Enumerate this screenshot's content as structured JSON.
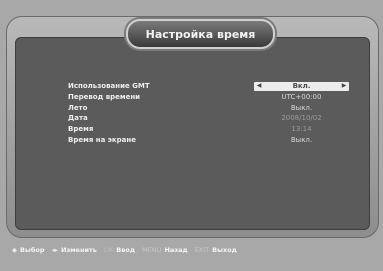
{
  "window": {
    "title": "Настройка время"
  },
  "settings": [
    {
      "label": "Использование GMT",
      "value": "Вкл.",
      "selected": true
    },
    {
      "label": "Перевод времени",
      "value": "UTC+00:00",
      "selected": false
    },
    {
      "label": "Лето",
      "value": "Выкл.",
      "selected": false
    },
    {
      "label": "Дата",
      "value": "2008/10/02",
      "selected": false
    },
    {
      "label": "Время",
      "value": "13:14",
      "selected": false
    },
    {
      "label": "Время на экране",
      "value": "Выкл.",
      "selected": false
    }
  ],
  "footer": {
    "hints": [
      {
        "key": "◆",
        "label": "Выбор"
      },
      {
        "key": "◂▸",
        "label": "Изменить"
      },
      {
        "key": "OK",
        "label": "Ввод"
      },
      {
        "key": "MENU",
        "label": "Назад"
      },
      {
        "key": "EXIT",
        "label": "Выход"
      }
    ]
  },
  "icons": {
    "left_arrow": "left-arrow-icon",
    "right_arrow": "right-arrow-icon"
  },
  "colors": {
    "panel": "#5b5b5b",
    "frame": "#b0b0b0",
    "selected_bg": "#ececec"
  }
}
